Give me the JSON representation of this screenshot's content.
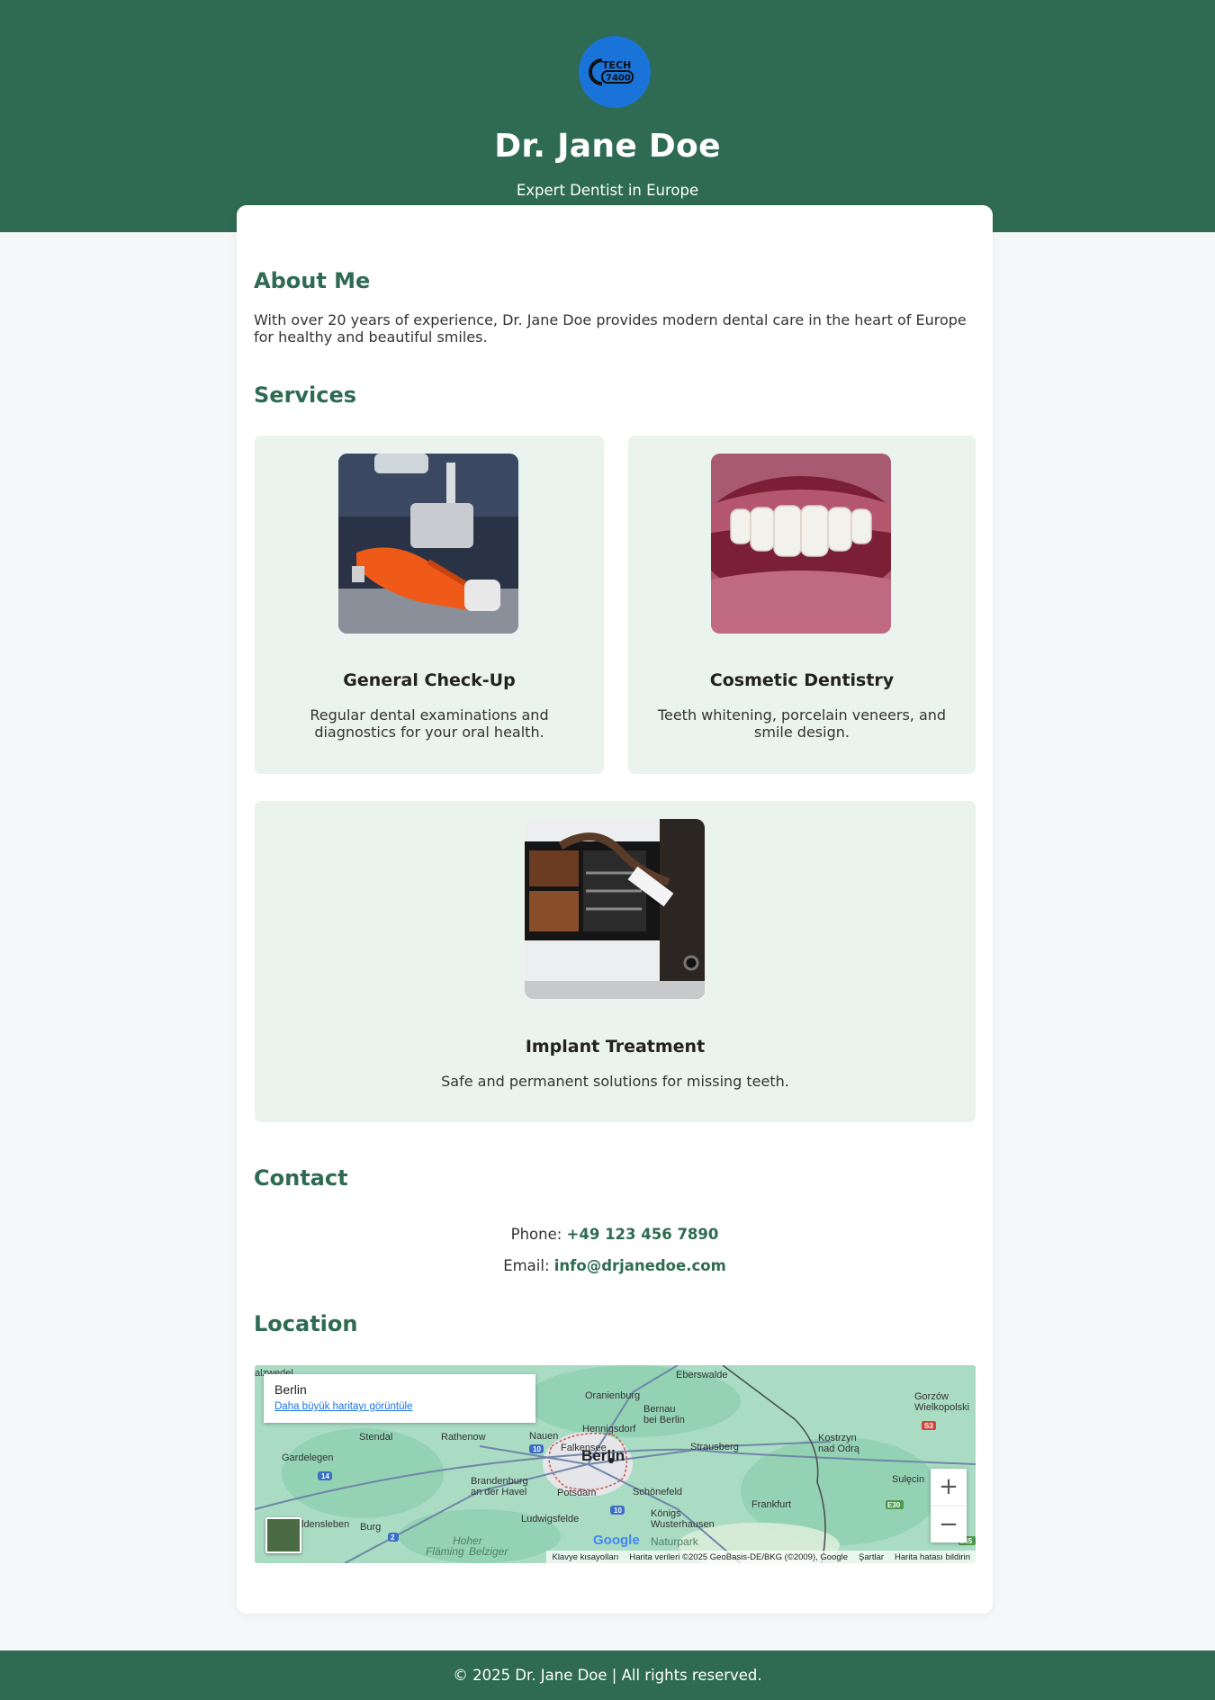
{
  "header": {
    "logo_text_top": "TECH",
    "logo_text_bottom": "7400",
    "name": "Dr. Jane Doe",
    "tagline": "Expert Dentist in Europe"
  },
  "about": {
    "title": "About Me",
    "text": "With over 20 years of experience, Dr. Jane Doe provides modern dental care in the heart of Europe for healthy and beautiful smiles."
  },
  "services": {
    "title": "Services",
    "items": [
      {
        "title": "General Check-Up",
        "description": "Regular dental examinations and diagnostics for your oral health.",
        "image": "dental-chair"
      },
      {
        "title": "Cosmetic Dentistry",
        "description": "Teeth whitening, porcelain veneers, and smile design.",
        "image": "smile"
      },
      {
        "title": "Implant Treatment",
        "description": "Safe and permanent solutions for missing teeth.",
        "image": "xray-review"
      }
    ]
  },
  "contact": {
    "title": "Contact",
    "phone_label": "Phone:",
    "phone": "+49 123 456 7890",
    "email_label": "Email:",
    "email": "info@drjanedoe.com"
  },
  "location": {
    "title": "Location",
    "map": {
      "place_name": "Berlin",
      "view_larger": "Daha büyük haritayı görüntüle",
      "zoom_in": "+",
      "zoom_out": "−",
      "google": "Google",
      "attribution": [
        "Klavye kısayolları",
        "Harita verileri ©2025 GeoBasis-DE/BKG (©2009), Google",
        "Şartlar",
        "Harita hatası bildirin"
      ],
      "labels": {
        "berlin": "Berlin",
        "oranienburg": "Oranienburg",
        "eberswalde": "Eberswalde",
        "bernau": "Bernau",
        "bernau2": "bei Berlin",
        "hennigsdorf": "Hennigsdorf",
        "nauen": "Nauen",
        "falkensee": "Falkensee",
        "strausberg": "Strausberg",
        "kostrzyn": "Kostrzyn",
        "kostrzyn2": "nad Odrą",
        "gorzow": "Gorzów",
        "wielkopolski": "Wielkopolski",
        "stendal": "Stendal",
        "rathenow": "Rathenow",
        "gardelegen": "Gardelegen",
        "brandenburg": "Brandenburg",
        "brandenburg2": "an der Havel",
        "potsdam": "Potsdam",
        "schonefeld": "Schönefeld",
        "konigs": "Königs",
        "wusterhausen": "Wusterhausen",
        "ludwigsfelde": "Ludwigsfelde",
        "frankfurt": "Frankfurt",
        "sulecin": "Sulęcin",
        "burg": "Burg",
        "haldensleben": "ldensleben",
        "salzwedel": "alzwedel",
        "hoher": "Hoher",
        "flaming": "Fläming",
        "belziger": "Belziger",
        "naturpark": "Naturpark",
        "r10": "10",
        "r10b": "10",
        "r14": "14",
        "r2": "2",
        "s3": "S3",
        "e30": "E30",
        "e65": "E65"
      }
    }
  },
  "footer": {
    "text": "© 2025 Dr. Jane Doe | All rights reserved."
  },
  "colors": {
    "brand_green": "#2e6b52",
    "card_mint": "#eaf3ee",
    "logo_blue": "#1a73d9",
    "link_blue": "#1a73e8"
  }
}
